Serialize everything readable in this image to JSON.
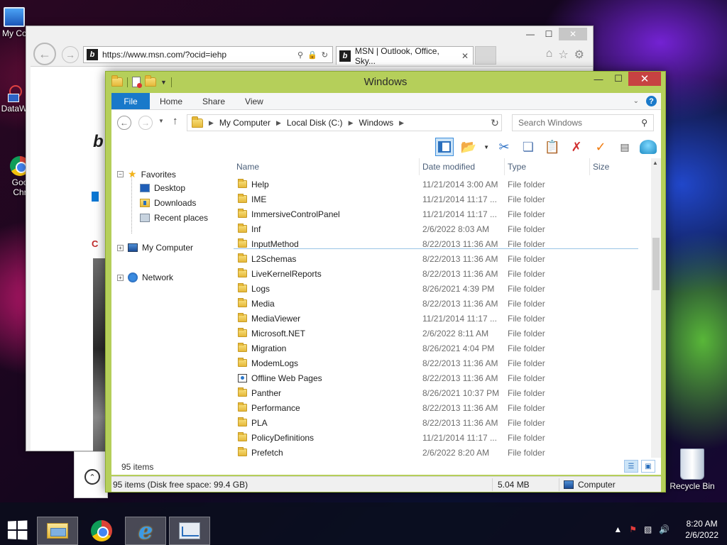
{
  "desktop": {
    "icons": [
      {
        "label": "My Co"
      },
      {
        "label": "DataW"
      },
      {
        "label": "Goo\nChr"
      },
      {
        "label": "Recycle Bin"
      }
    ]
  },
  "browser": {
    "url": "https://www.msn.com/?ocid=iehp",
    "tab_title": "MSN | Outlook, Office, Sky...",
    "partial_red_text": "C",
    "partial_logo": "b"
  },
  "explorer": {
    "title": "Windows",
    "ribbon_tabs": [
      "File",
      "Home",
      "Share",
      "View"
    ],
    "breadcrumbs": [
      "My Computer",
      "Local Disk (C:)",
      "Windows"
    ],
    "search_placeholder": "Search Windows",
    "nav": {
      "favorites": "Favorites",
      "desktop": "Desktop",
      "downloads": "Downloads",
      "recent": "Recent places",
      "computer": "My Computer",
      "network": "Network"
    },
    "columns": {
      "name": "Name",
      "date": "Date modified",
      "type": "Type",
      "size": "Size"
    },
    "files": [
      {
        "name": "Help",
        "date": "11/21/2014 3:00 AM",
        "type": "File folder"
      },
      {
        "name": "IME",
        "date": "11/21/2014 11:17 ...",
        "type": "File folder"
      },
      {
        "name": "ImmersiveControlPanel",
        "date": "11/21/2014 11:17 ...",
        "type": "File folder"
      },
      {
        "name": "Inf",
        "date": "2/6/2022 8:03 AM",
        "type": "File folder"
      },
      {
        "name": "InputMethod",
        "date": "8/22/2013 11:36 AM",
        "type": "File folder"
      },
      {
        "name": "L2Schemas",
        "date": "8/22/2013 11:36 AM",
        "type": "File folder"
      },
      {
        "name": "LiveKernelReports",
        "date": "8/22/2013 11:36 AM",
        "type": "File folder"
      },
      {
        "name": "Logs",
        "date": "8/26/2021 4:39 PM",
        "type": "File folder"
      },
      {
        "name": "Media",
        "date": "8/22/2013 11:36 AM",
        "type": "File folder"
      },
      {
        "name": "MediaViewer",
        "date": "11/21/2014 11:17 ...",
        "type": "File folder"
      },
      {
        "name": "Microsoft.NET",
        "date": "2/6/2022 8:11 AM",
        "type": "File folder"
      },
      {
        "name": "Migration",
        "date": "8/26/2021 4:04 PM",
        "type": "File folder"
      },
      {
        "name": "ModemLogs",
        "date": "8/22/2013 11:36 AM",
        "type": "File folder"
      },
      {
        "name": "Offline Web Pages",
        "date": "8/22/2013 11:36 AM",
        "type": "File folder"
      },
      {
        "name": "Panther",
        "date": "8/26/2021 10:37 PM",
        "type": "File folder"
      },
      {
        "name": "Performance",
        "date": "8/22/2013 11:36 AM",
        "type": "File folder"
      },
      {
        "name": "PLA",
        "date": "8/22/2013 11:36 AM",
        "type": "File folder"
      },
      {
        "name": "PolicyDefinitions",
        "date": "11/21/2014 11:17 ...",
        "type": "File folder"
      },
      {
        "name": "Prefetch",
        "date": "2/6/2022 8:20 AM",
        "type": "File folder"
      }
    ],
    "item_count": "95 items",
    "status_detail": "95 items (Disk free space: 99.4 GB)",
    "status_size": "5.04 MB",
    "status_location": "Computer"
  },
  "taskbar": {
    "time": "8:20 AM",
    "date": "2/6/2022"
  }
}
